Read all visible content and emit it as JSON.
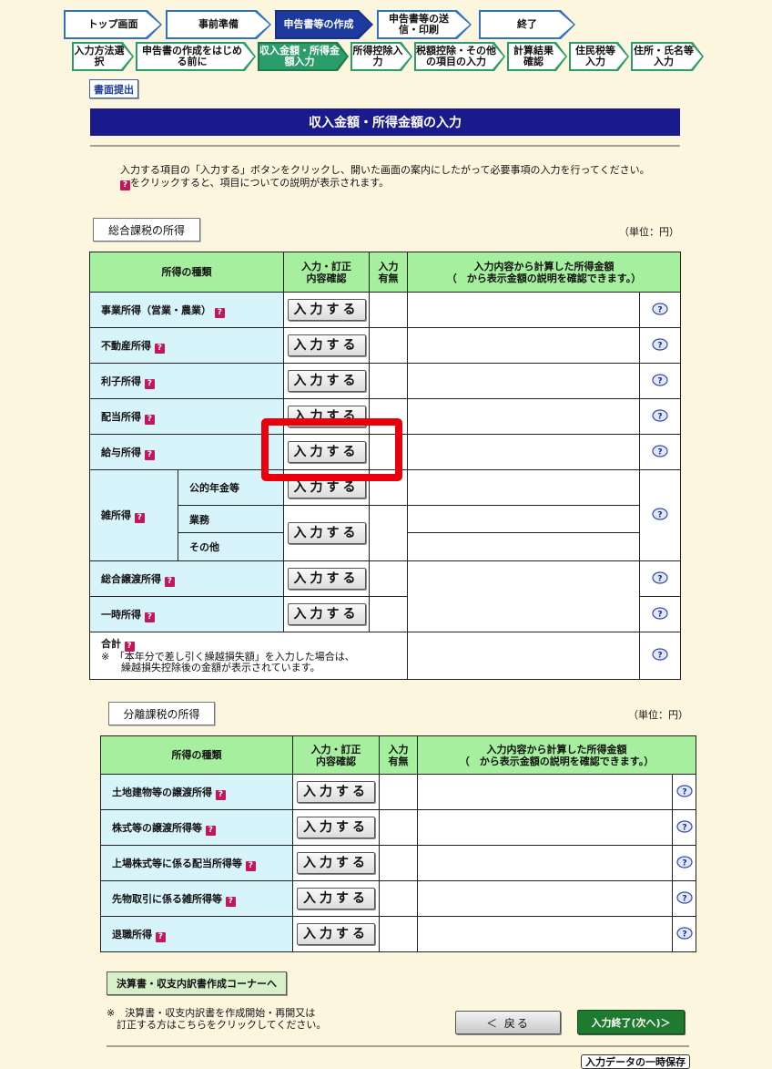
{
  "top_steps": [
    "トップ画面",
    "事前準備",
    "申告書等の作成",
    "申告書等の送信・印刷",
    "終了"
  ],
  "sub_steps": [
    "入力方法選択",
    "申告書の作成をはじめる前に",
    "収入金額・所得金額入力",
    "所得控除入力",
    "税額控除・その他の項目の入力",
    "計算結果確認",
    "住民税等入力",
    "住所・氏名等入力"
  ],
  "document_submit_label": "書面提出",
  "page_title": "収入金額・所得金額の入力",
  "instructions": {
    "line1": "入力する項目の「入力する」ボタンをクリックし、開いた画面の案内にしたがって必要事項の入力を行ってください。",
    "line2": "をクリックすると、項目についての説明が表示されます。"
  },
  "unit_label": "（単位：円）",
  "table_headers": {
    "kind": "所得の種類",
    "confirm": "入力・訂正\n内容確認",
    "has_input": "入力\n有無",
    "amount": "入力内容から計算した所得金額",
    "amount_note": "（　から表示金額の説明を確認できます。）"
  },
  "input_button_label": "入力する",
  "sogo": {
    "section_label": "総合課税の所得",
    "rows": [
      "事業所得（営業・農業）",
      "不動産所得",
      "利子所得",
      "配当所得",
      "給与所得"
    ],
    "misc_label": "雑所得",
    "misc_subrows": [
      "公的年金等",
      "業務",
      "その他"
    ],
    "rows_after": [
      "総合譲渡所得",
      "一時所得"
    ],
    "total_label": "合計",
    "total_note": "※　「本年分で差し引く繰越損失額」を入力した場合は、\n　　繰越損失控除後の金額が表示されています。"
  },
  "bunri": {
    "section_label": "分離課税の所得",
    "rows": [
      "土地建物等の譲渡所得",
      "株式等の譲渡所得等",
      "上場株式等に係る配当所得等",
      "先物取引に係る雑所得等",
      "退職所得"
    ]
  },
  "footer": {
    "statement_button": "決算書・収支内訳書作成コーナーへ",
    "note": "※　決算書・収支内訳書を作成開始・再開又は\n　訂正する方はこちらをクリックしてください。",
    "back_button": "＜ 戻る",
    "next_button": "入力終了(次へ)＞",
    "save_button": "入力データの一時保存"
  },
  "colors": {
    "header_green": "#a5ef9e",
    "category_blue": "#d8f4fb",
    "title_navy": "#1a1a8c",
    "highlight_red": "#e8000c",
    "help_mark": "#c2185b"
  }
}
